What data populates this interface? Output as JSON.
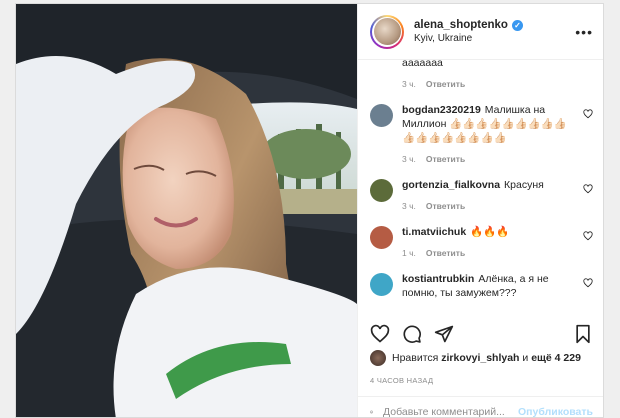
{
  "post": {
    "username": "alena_shoptenko",
    "location": "Kyiv, Ukraine",
    "more_label": "•••"
  },
  "comments": [
    {
      "user": "",
      "text": "ааааааа",
      "time": "3 ч.",
      "reply": "Ответить",
      "avatar_color": "#9a8a7a"
    },
    {
      "user": "bogdan2320219",
      "text": "Малишка на Миллион ​👍🏻👍🏻👍🏻👍🏻👍🏻👍🏻👍🏻👍🏻👍🏻👍🏻👍🏻👍🏻👍🏻👍🏻👍🏻👍🏻👍🏻",
      "time": "3 ч.",
      "reply": "Ответить",
      "avatar_color": "#6b7f90"
    },
    {
      "user": "gortenzia_fialkovna",
      "text": "Красуня",
      "time": "3 ч.",
      "reply": "Ответить",
      "avatar_color": "#5c6b3a"
    },
    {
      "user": "ti.matviichuk",
      "text": "🔥🔥🔥",
      "time": "1 ч.",
      "reply": "Ответить",
      "avatar_color": "#b55c44"
    },
    {
      "user": "kostiantrubkin",
      "text": "Алёнка, а я не помню, ты замужем???",
      "time": "",
      "reply": "",
      "avatar_color": "#3fa6c7"
    }
  ],
  "likes": {
    "prefix": "Нравится",
    "user": "zirkovyi_shlyah",
    "middle": "и",
    "count": "ещё 4 229"
  },
  "timestamp": "4 ЧАСОВ НАЗАД",
  "add_comment": {
    "placeholder": "Добавьте комментарий...",
    "publish_label": "Опубликовать"
  },
  "colors": {
    "verified": "#3897f0",
    "publish_disabled": "#b2dffc",
    "secondary_text": "#8e8e8e"
  }
}
